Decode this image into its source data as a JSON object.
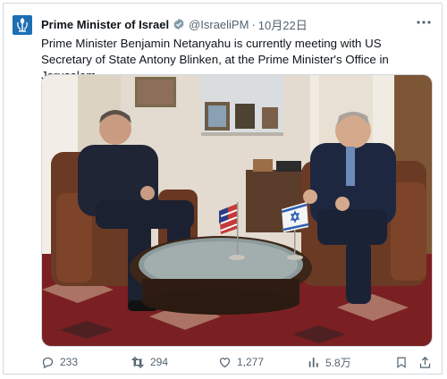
{
  "tweet": {
    "author_name": "Prime Minister of Israel",
    "handle": "@IsraeliPM",
    "separator": "·",
    "date": "10月22日",
    "text": "Prime Minister Benjamin Netanyahu is currently meeting with US Secretary of State Antony Blinken, at the Prime Minister's Office in Jerusalem."
  },
  "actions": {
    "replies": "233",
    "retweets": "294",
    "likes": "1,277",
    "views": "5.8万"
  },
  "colors": {
    "avatar_bg": "#1d6fb5",
    "verified_badge": "#829aab",
    "secondary_text": "#536471"
  }
}
